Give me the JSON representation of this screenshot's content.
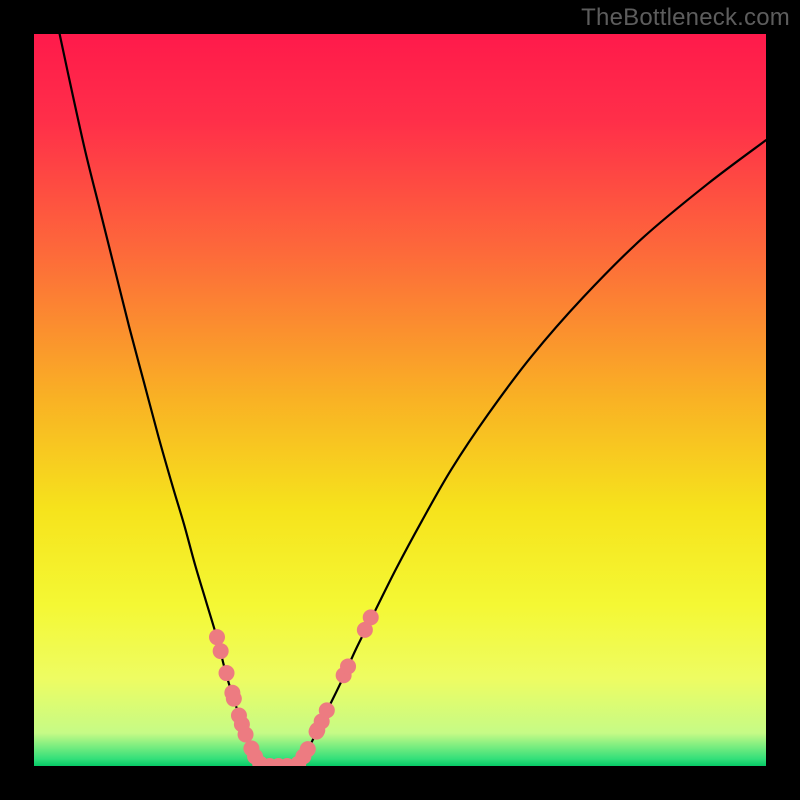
{
  "watermark": "TheBottleneck.com",
  "chart_data": {
    "type": "line",
    "title": "",
    "xlabel": "",
    "ylabel": "",
    "xlim": [
      0,
      100
    ],
    "ylim": [
      0,
      100
    ],
    "gradient_stops": [
      {
        "offset": 0.0,
        "color": "#ff1a4b"
      },
      {
        "offset": 0.12,
        "color": "#ff2f49"
      },
      {
        "offset": 0.3,
        "color": "#fd6a3a"
      },
      {
        "offset": 0.5,
        "color": "#f9b224"
      },
      {
        "offset": 0.65,
        "color": "#f6e31c"
      },
      {
        "offset": 0.78,
        "color": "#f4f834"
      },
      {
        "offset": 0.88,
        "color": "#eefc62"
      },
      {
        "offset": 0.955,
        "color": "#c6fb86"
      },
      {
        "offset": 0.99,
        "color": "#34e07a"
      },
      {
        "offset": 1.0,
        "color": "#07c966"
      }
    ],
    "series": [
      {
        "name": "left-branch",
        "x": [
          3.5,
          5,
          7,
          9,
          11,
          13,
          15,
          17,
          19,
          20.5,
          22,
          23.5,
          25,
          26,
          27,
          28,
          28.8,
          29.5,
          30.1,
          30.6,
          31.0
        ],
        "y": [
          100,
          93,
          84,
          76,
          68,
          60,
          52.5,
          45,
          38,
          33,
          27.5,
          22.5,
          17.5,
          13.5,
          10,
          7,
          4.6,
          2.8,
          1.5,
          0.6,
          0.1
        ]
      },
      {
        "name": "valley-flat",
        "x": [
          31.0,
          32.0,
          33.0,
          34.0,
          35.0,
          36.0
        ],
        "y": [
          0.1,
          0.0,
          0.0,
          0.0,
          0.0,
          0.1
        ]
      },
      {
        "name": "right-branch",
        "x": [
          36.0,
          36.8,
          37.8,
          39,
          40.5,
          42.2,
          44,
          46.5,
          49.5,
          53,
          57,
          62,
          68,
          75,
          83,
          92,
          100
        ],
        "y": [
          0.1,
          1.2,
          3.0,
          5.5,
          8.5,
          12,
          16,
          21,
          27,
          33.5,
          40.5,
          48,
          56,
          64,
          72,
          79.5,
          85.5
        ]
      }
    ],
    "markers": {
      "name": "highlighted-points",
      "color": "#ed7b81",
      "radius_px": 8,
      "points": [
        {
          "x": 25.0,
          "y": 17.6
        },
        {
          "x": 25.5,
          "y": 15.7
        },
        {
          "x": 26.3,
          "y": 12.7
        },
        {
          "x": 27.1,
          "y": 10.0
        },
        {
          "x": 27.3,
          "y": 9.2
        },
        {
          "x": 28.0,
          "y": 6.9
        },
        {
          "x": 28.4,
          "y": 5.7
        },
        {
          "x": 28.9,
          "y": 4.3
        },
        {
          "x": 29.7,
          "y": 2.4
        },
        {
          "x": 30.2,
          "y": 1.3
        },
        {
          "x": 30.9,
          "y": 0.3
        },
        {
          "x": 32.2,
          "y": 0.0
        },
        {
          "x": 33.4,
          "y": 0.0
        },
        {
          "x": 34.6,
          "y": 0.0
        },
        {
          "x": 36.1,
          "y": 0.3
        },
        {
          "x": 36.8,
          "y": 1.3
        },
        {
          "x": 37.4,
          "y": 2.3
        },
        {
          "x": 38.6,
          "y": 4.7
        },
        {
          "x": 38.7,
          "y": 4.9
        },
        {
          "x": 39.3,
          "y": 6.1
        },
        {
          "x": 40.0,
          "y": 7.6
        },
        {
          "x": 42.3,
          "y": 12.4
        },
        {
          "x": 42.9,
          "y": 13.6
        },
        {
          "x": 45.2,
          "y": 18.6
        },
        {
          "x": 46.0,
          "y": 20.3
        }
      ]
    }
  }
}
